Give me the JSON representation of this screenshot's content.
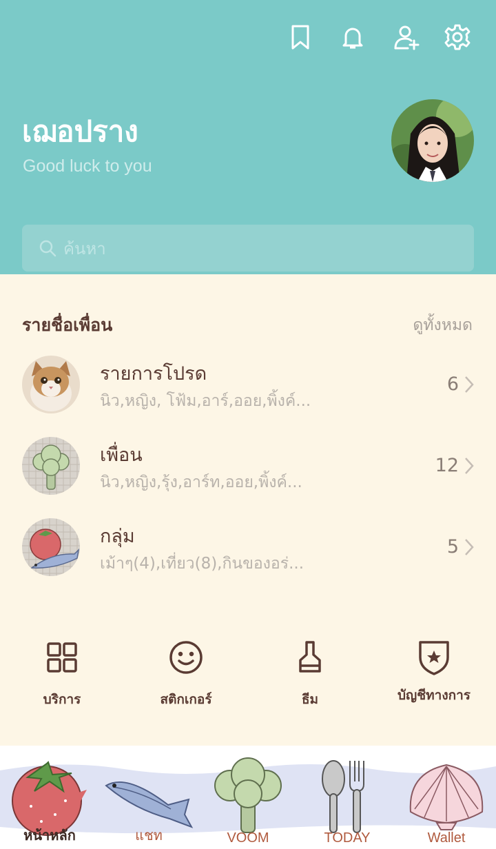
{
  "header": {
    "icons": [
      "bookmark-icon",
      "bell-icon",
      "add-friend-icon",
      "gear-icon"
    ],
    "bg_color": "#7bcac8"
  },
  "profile": {
    "name": "เฌอปราง",
    "status": "Good luck to you"
  },
  "search": {
    "placeholder": "ค้นหา"
  },
  "friends": {
    "title": "รายชื่อเพื่อน",
    "see_all": "ดูทั้งหมด",
    "rows": [
      {
        "title": "รายการโปรด",
        "subtitle": "นิว,หญิง, โฟ้ม,อาร์,ออย,พิ้งค์...",
        "count": "6"
      },
      {
        "title": "เพื่อน",
        "subtitle": "นิว,หญิง,รุ้ง,อาร์ท,ออย,พิ้งค์...",
        "count": "12"
      },
      {
        "title": "กลุ่ม",
        "subtitle": "เม้าๆ(4),เที่ยว(8),กินของอร่...",
        "count": "5"
      }
    ]
  },
  "services": [
    {
      "label": "บริการ",
      "icon": "grid-icon"
    },
    {
      "label": "สติกเกอร์",
      "icon": "smile-icon"
    },
    {
      "label": "ธีม",
      "icon": "brush-icon"
    },
    {
      "label": "บัญชีทางการ",
      "icon": "shield-star-icon"
    }
  ],
  "tabs": [
    {
      "label": "หน้าหลัก",
      "icon": "tomato-icon",
      "active": true
    },
    {
      "label": "แชท",
      "icon": "fish-icon",
      "active": false
    },
    {
      "label": "VOOM",
      "icon": "broccoli-icon",
      "active": false
    },
    {
      "label": "TODAY",
      "icon": "cutlery-icon",
      "active": false
    },
    {
      "label": "Wallet",
      "icon": "shell-icon",
      "active": false
    }
  ],
  "colors": {
    "accent": "#7bcac8",
    "text_dark": "#5a3b33",
    "background": "#fdf6e6"
  }
}
